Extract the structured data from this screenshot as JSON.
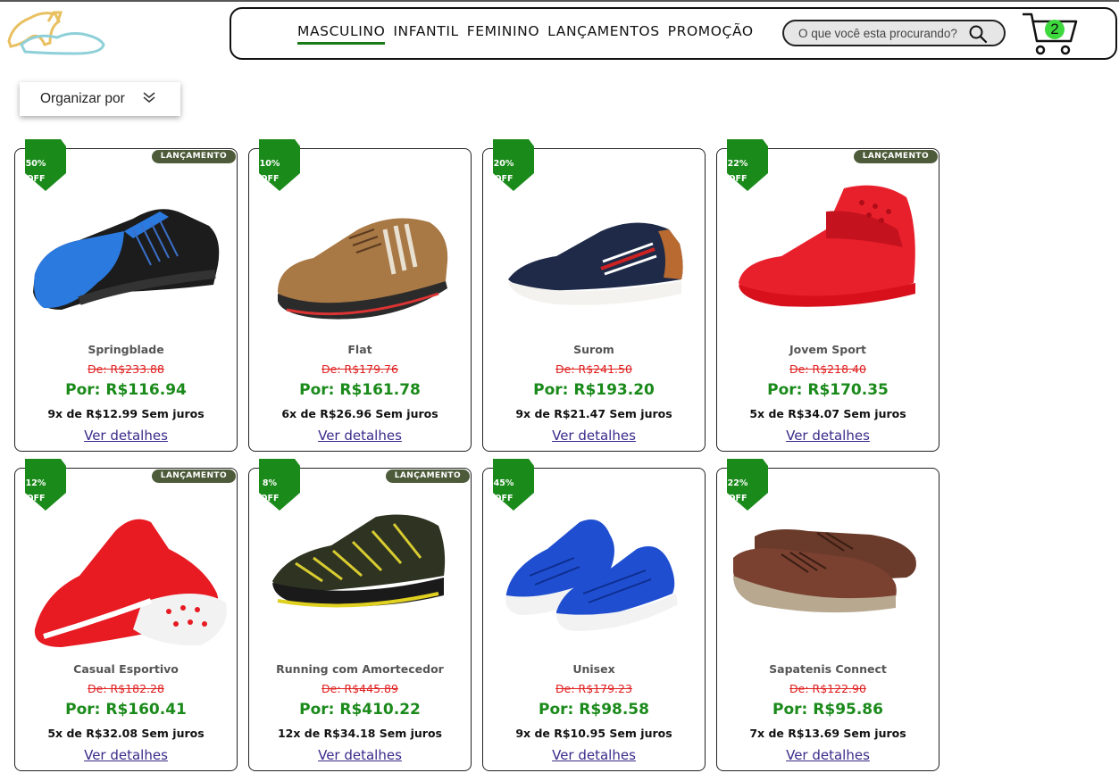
{
  "header": {
    "nav": [
      "MASCULINO",
      "INFANTIL",
      "FEMININO",
      "LANÇAMENTOS",
      "PROMOÇÃO"
    ],
    "active_nav": "MASCULINO",
    "search_placeholder": "O que você esta procurando?",
    "cart_count": "2"
  },
  "sort": {
    "label": "Organizar por"
  },
  "colors": {
    "accent_green": "#1a8a1a",
    "old_price_red": "#e02020",
    "badge": "#4d5b3a"
  },
  "products": [
    {
      "discount": "50%",
      "off": "OFF",
      "badge": "LANÇAMENTO",
      "name": "Springblade",
      "old_price": "De: R$233.88",
      "price": "Por: R$116.94",
      "installments": "9x de R$12.99 Sem juros",
      "link": "Ver detalhes",
      "image": "blue-black-running-shoe"
    },
    {
      "discount": "10%",
      "off": "OFF",
      "badge": "",
      "name": "Flat",
      "old_price": "De: R$179.76",
      "price": "Por: R$161.78",
      "installments": "6x de R$26.96 Sem juros",
      "link": "Ver detalhes",
      "image": "brown-suede-shoe"
    },
    {
      "discount": "20%",
      "off": "OFF",
      "badge": "",
      "name": "Surom",
      "old_price": "De: R$241.50",
      "price": "Por: R$193.20",
      "installments": "9x de R$21.47 Sem juros",
      "link": "Ver detalhes",
      "image": "navy-casual-sneaker"
    },
    {
      "discount": "22%",
      "off": "OFF",
      "badge": "LANÇAMENTO",
      "name": "Jovem Sport",
      "old_price": "De: R$218.40",
      "price": "Por: R$170.35",
      "installments": "5x de R$34.07 Sem juros",
      "link": "Ver detalhes",
      "image": "red-high-top-sneaker"
    },
    {
      "discount": "12%",
      "off": "OFF",
      "badge": "LANÇAMENTO",
      "name": "Casual Esportivo",
      "old_price": "De: R$182.28",
      "price": "Por: R$160.41",
      "installments": "5x de R$32.08 Sem juros",
      "link": "Ver detalhes",
      "image": "red-knit-sneaker"
    },
    {
      "discount": "8%",
      "off": "OFF",
      "badge": "LANÇAMENTO",
      "name": "Running com Amortecedor",
      "old_price": "De: R$445.89",
      "price": "Por: R$410.22",
      "installments": "12x de R$34.18 Sem juros",
      "link": "Ver detalhes",
      "image": "black-yellow-air-runner"
    },
    {
      "discount": "45%",
      "off": "OFF",
      "badge": "",
      "name": "Unisex",
      "old_price": "De: R$179.23",
      "price": "Por: R$98.58",
      "installments": "9x de R$10.95 Sem juros",
      "link": "Ver detalhes",
      "image": "blue-knit-sneakers-pair"
    },
    {
      "discount": "22%",
      "off": "OFF",
      "badge": "",
      "name": "Sapatenis Connect",
      "old_price": "De: R$122.90",
      "price": "Por: R$95.86",
      "installments": "7x de R$13.69 Sem juros",
      "link": "Ver detalhes",
      "image": "brown-leather-sneakers-pair"
    }
  ]
}
